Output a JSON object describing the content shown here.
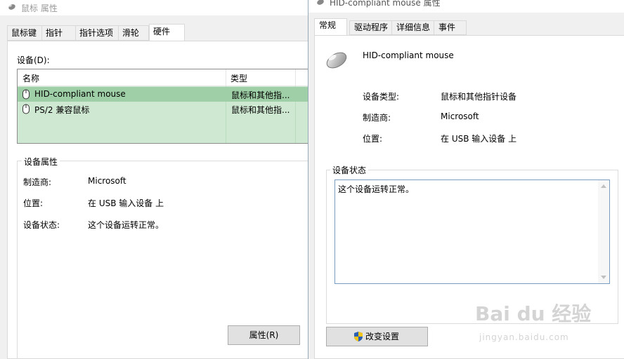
{
  "left_window": {
    "title": "鼠标 属性",
    "tabs": [
      {
        "label": "鼠标键",
        "active": false
      },
      {
        "label": "指针",
        "active": false
      },
      {
        "label": "指针选项",
        "active": false
      },
      {
        "label": "滑轮",
        "active": false
      },
      {
        "label": "硬件",
        "active": true
      }
    ],
    "devices_label": "设备(D):",
    "columns": {
      "name": "名称",
      "type": "类型"
    },
    "devices": [
      {
        "name": "HID-compliant mouse",
        "type": "鼠标和其他指...",
        "selected": true,
        "icon": "mouse-icon"
      },
      {
        "name": "PS/2 兼容鼠标",
        "type": "鼠标和其他指...",
        "selected": false,
        "icon": "mouse-icon"
      }
    ],
    "properties_group": {
      "title": "设备属性",
      "manufacturer_label": "制造商:",
      "manufacturer": "Microsoft",
      "location_label": "位置:",
      "location": "在 USB 输入设备 上",
      "status_label": "设备状态:",
      "status": "这个设备运转正常。"
    },
    "properties_button": "属性(R)"
  },
  "right_window": {
    "title": "HID-compliant mouse 属性",
    "tabs": [
      {
        "label": "常规",
        "active": true
      },
      {
        "label": "驱动程序",
        "active": false
      },
      {
        "label": "详细信息",
        "active": false
      },
      {
        "label": "事件",
        "active": false
      }
    ],
    "device_name": "HID-compliant mouse",
    "device_type_label": "设备类型:",
    "device_type": "鼠标和其他指针设备",
    "manufacturer_label": "制造商:",
    "manufacturer": "Microsoft",
    "location_label": "位置:",
    "location": "在 USB 输入设备 上",
    "status_group_title": "设备状态",
    "status_text": "这个设备运转正常。",
    "change_settings_button": "改变设置"
  },
  "watermark": {
    "text": "Bai du 经验",
    "sub": "jingyan.baidu.com"
  },
  "colors": {
    "selection_green": "#9fcfa6",
    "list_bg_green": "#cfe8d2",
    "border_gray": "#d9d9d9",
    "button_gray": "#e1e1e1"
  }
}
